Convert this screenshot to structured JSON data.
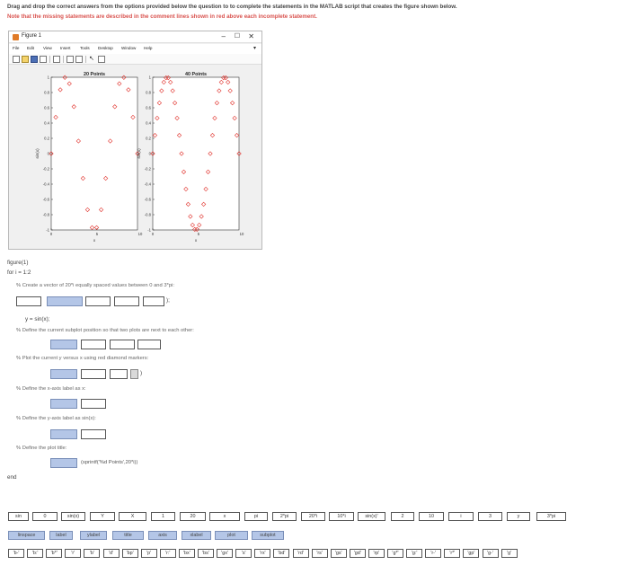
{
  "instructions": "Drag and drop the correct answers from the options provided below the question to to complete the statements in the MATLAB script that creates the figure shown below.",
  "note": "Note that the missing statements are described in the comment lines shown in red above each incomplete statement.",
  "figure": {
    "window_title": "Figure 1",
    "menu": [
      "File",
      "Edit",
      "View",
      "Insert",
      "Tools",
      "Desktop",
      "Window",
      "Help"
    ],
    "colors": {
      "marker": "#e0302a",
      "axes_bg": "#ffffff",
      "window_bg": "#f0f0f0"
    }
  },
  "chart_data": [
    {
      "type": "scatter",
      "title": "20 Points",
      "xlabel": "x",
      "ylabel": "sin(x)",
      "xlim": [
        0,
        9.42
      ],
      "ylim": [
        -1,
        1
      ],
      "xticks": [
        "0",
        "5",
        "10"
      ],
      "yticks": [
        "1",
        "0.8",
        "0.6",
        "0.4",
        "0.2",
        "0",
        "-0.2",
        "-0.4",
        "-0.6",
        "-0.8",
        "-1"
      ],
      "marker": "diamond",
      "x": [
        0,
        0.496,
        0.992,
        1.488,
        1.984,
        2.48,
        2.976,
        3.472,
        3.967,
        4.463,
        4.959,
        5.455,
        5.951,
        6.447,
        6.943,
        7.439,
        7.935,
        8.431,
        8.927,
        9.425
      ],
      "y": [
        0,
        0.476,
        0.837,
        0.997,
        0.916,
        0.614,
        0.165,
        -0.324,
        -0.735,
        -0.969,
        -0.969,
        -0.735,
        -0.324,
        0.165,
        0.614,
        0.916,
        0.997,
        0.837,
        0.476,
        0
      ]
    },
    {
      "type": "scatter",
      "title": "40 Points",
      "xlabel": "x",
      "ylabel": "sin(x)",
      "xlim": [
        0,
        9.42
      ],
      "ylim": [
        -1,
        1
      ],
      "xticks": [
        "0",
        "5",
        "10"
      ],
      "yticks": [
        "1",
        "0.8",
        "0.6",
        "0.4",
        "0.2",
        "0",
        "-0.2",
        "-0.4",
        "-0.6",
        "-0.8",
        "-1"
      ],
      "marker": "diamond",
      "x": [
        0,
        0.242,
        0.483,
        0.725,
        0.966,
        1.208,
        1.45,
        1.691,
        1.933,
        2.175,
        2.416,
        2.658,
        2.899,
        3.141,
        3.383,
        3.624,
        3.866,
        4.107,
        4.349,
        4.591,
        4.832,
        5.074,
        5.315,
        5.557,
        5.799,
        6.04,
        6.282,
        6.524,
        6.765,
        7.007,
        7.248,
        7.49,
        7.732,
        7.973,
        8.215,
        8.456,
        8.698,
        8.94,
        9.181,
        9.425
      ],
      "y": [
        0,
        0.239,
        0.465,
        0.663,
        0.823,
        0.935,
        0.993,
        0.993,
        0.935,
        0.823,
        0.663,
        0.465,
        0.239,
        0,
        -0.239,
        -0.465,
        -0.663,
        -0.823,
        -0.935,
        -0.993,
        -0.993,
        -0.935,
        -0.823,
        -0.663,
        -0.465,
        -0.239,
        0,
        0.239,
        0.465,
        0.663,
        0.823,
        0.935,
        0.993,
        0.993,
        0.935,
        0.823,
        0.663,
        0.465,
        0.239,
        0
      ]
    }
  ],
  "script": {
    "line_figure": "figure(1)",
    "line_for": "for i = 1:2",
    "comment1": "% Create a vector of 20*i equally spaced values between 0 and 3*pi:",
    "line_y": "y = sin(x);",
    "comment2": "% Define the current subplot position so that two plots are next to each other:",
    "comment3": "% Plot the current y versus x using red diamond markers:",
    "comment4": "% Define the x-axis label as x:",
    "comment5": "% Define the y-axis label as sin(x):",
    "comment6": "% Define the plot title:",
    "title_arg": "(sprintf('%d Points',20*i))",
    "end": "end",
    "semicolon": ");"
  },
  "options_row1": [
    "sin",
    "0",
    "sin(x)",
    "Y",
    "X",
    "1",
    "20",
    "x",
    "pi",
    "2*pi",
    "20*i",
    "10*i",
    "sin(x)'",
    "2",
    "10",
    "i",
    "3",
    "y",
    "3*pi"
  ],
  "options_row2": [
    "linspace",
    "label",
    "ylabel",
    "title",
    "axis",
    "xlabel",
    "plot",
    "subplot"
  ],
  "options_row3": [
    "'b-'",
    "'b:'",
    "'b*'",
    "'r'",
    "'b'",
    "'d'",
    "'bp'",
    "'p'",
    "'r:'",
    "'bx'",
    "'bs'",
    "'gx'",
    "'s'",
    "'rx'",
    "'bd'",
    "'rd'",
    "'rs'",
    "'gs'",
    "'gd'",
    "'rp'",
    "'g*'",
    "'g:'",
    "'r-'",
    "'r*'",
    "'gp'",
    "'g-'",
    "'g'"
  ]
}
